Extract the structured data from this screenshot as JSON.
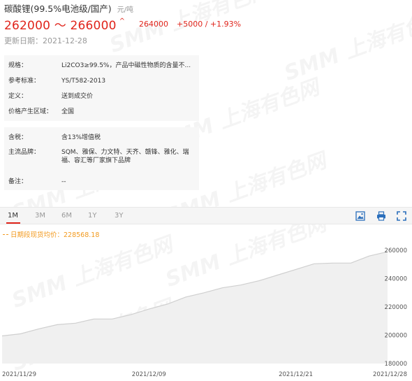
{
  "header": {
    "product_name": "碳酸锂(99.5%电池级/国产)",
    "unit": "元/吨",
    "price_range": "262000 ～ 266000",
    "avg_price": "264000",
    "change": "+5000 / +1.93%",
    "update_date": "更新日期：2021-12-28"
  },
  "info_box_1": [
    {
      "key": "规格：",
      "value": "Li2CO3≥99.5%，产品中磁性物质的含量不..."
    },
    {
      "key": "参考标准：",
      "value": "YS/T582-2013"
    },
    {
      "key": "定义：",
      "value": "送到成交价"
    },
    {
      "key": "价格产生区域：",
      "value": "全国"
    }
  ],
  "info_box_2": [
    {
      "key": "含税：",
      "value": "含13%增值税"
    },
    {
      "key": "主流品牌：",
      "value": "SQM、雅保、力文特、天齐、赣锋、雅化、瑞福、容汇等厂家旗下品牌"
    },
    {
      "key": "备注：",
      "value": "--"
    }
  ],
  "tabs": [
    "1M",
    "3M",
    "6M",
    "1Y",
    "3Y"
  ],
  "active_tab": "1M",
  "toolbar_icons": [
    "image-save-icon",
    "print-icon",
    "fullscreen-icon"
  ],
  "watermark": "SMM 上海有色网",
  "legend_text": "日期段现货均价：228568.18",
  "colors": {
    "accent_red": "#e0241b",
    "legend_orange": "#f29a1f",
    "line": "#cfcfcf",
    "area": "#f0f0f0"
  },
  "chart_data": {
    "type": "area",
    "x_ticks": [
      "2021/11/29",
      "2021/12/09",
      "2021/12/21",
      "2021/12/28"
    ],
    "y_ticks": [
      180000,
      200000,
      220000,
      240000,
      260000
    ],
    "ylim": [
      180000,
      265000
    ],
    "dates": [
      "2021/11/29",
      "2021/11/30",
      "2021/12/01",
      "2021/12/02",
      "2021/12/03",
      "2021/12/06",
      "2021/12/07",
      "2021/12/08",
      "2021/12/09",
      "2021/12/10",
      "2021/12/13",
      "2021/12/14",
      "2021/12/15",
      "2021/12/16",
      "2021/12/17",
      "2021/12/20",
      "2021/12/21",
      "2021/12/22",
      "2021/12/23",
      "2021/12/24",
      "2021/12/27",
      "2021/12/28"
    ],
    "values": [
      199500,
      201000,
      204500,
      207500,
      208500,
      211500,
      211500,
      214500,
      218500,
      222000,
      227000,
      230000,
      233500,
      235500,
      238500,
      242500,
      246500,
      250500,
      251000,
      251000,
      256000,
      259000
    ]
  }
}
